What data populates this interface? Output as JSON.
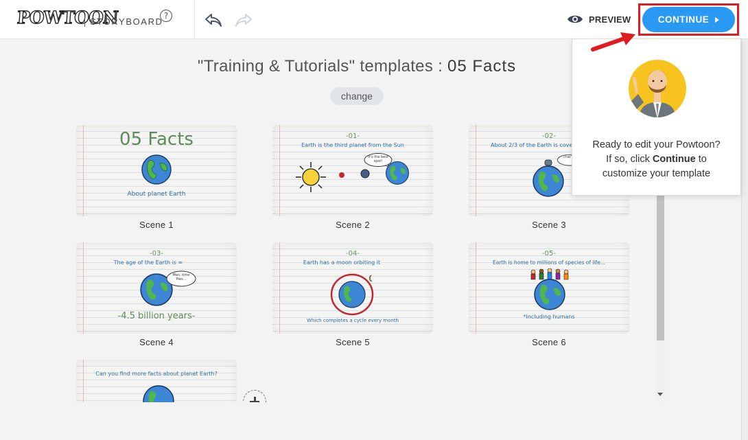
{
  "app": {
    "logo_text": "POWTOON",
    "section_label": "STORYBOARD",
    "help_glyph": "?"
  },
  "toolbar": {
    "undo_icon": "undo-arrow-icon",
    "redo_icon": "redo-arrow-icon",
    "preview_label": "PREVIEW",
    "continue_label": "CONTINUE"
  },
  "main": {
    "heading_prefix": "\"Training & Tutorials\" templates : ",
    "heading_name": "05 Facts",
    "change_label": "change"
  },
  "scenes": [
    {
      "label": "Scene 1",
      "big": "05 Facts",
      "bottom": "About planet Earth"
    },
    {
      "label": "Scene 2",
      "num": "-01-",
      "top": "Earth is the third planet from the Sun",
      "bubble": "It's the best spot!"
    },
    {
      "label": "Scene 3",
      "num": "-02-",
      "top": "About 2/3 of the Earth is cove",
      "bubble": "That's"
    },
    {
      "label": "Scene 4",
      "num": "-03-",
      "top": "The age of the Earth is ≈",
      "bubble": "Man, time flies...",
      "bottom": "-4.5 billion years-"
    },
    {
      "label": "Scene 5",
      "num": "-04-",
      "top": "Earth has a moon orbiting it",
      "bottom": "Which completes a cycle every month"
    },
    {
      "label": "Scene 6",
      "num": "-05-",
      "top": "Earth is home to millions of species of life...",
      "bottom": "*Including humans"
    },
    {
      "top": "Can you find more facts about planet Earth?"
    }
  ],
  "popover": {
    "line1": "Ready to edit your Powtoon?",
    "line2_prefix": "If so, click ",
    "line2_bold": "Continue",
    "line2_suffix": " to",
    "line3": "customize your template"
  },
  "colors": {
    "continue_blue": "#2a99f3",
    "highlight_red": "#e11b22",
    "avatar_yellow": "#f7c41f"
  }
}
